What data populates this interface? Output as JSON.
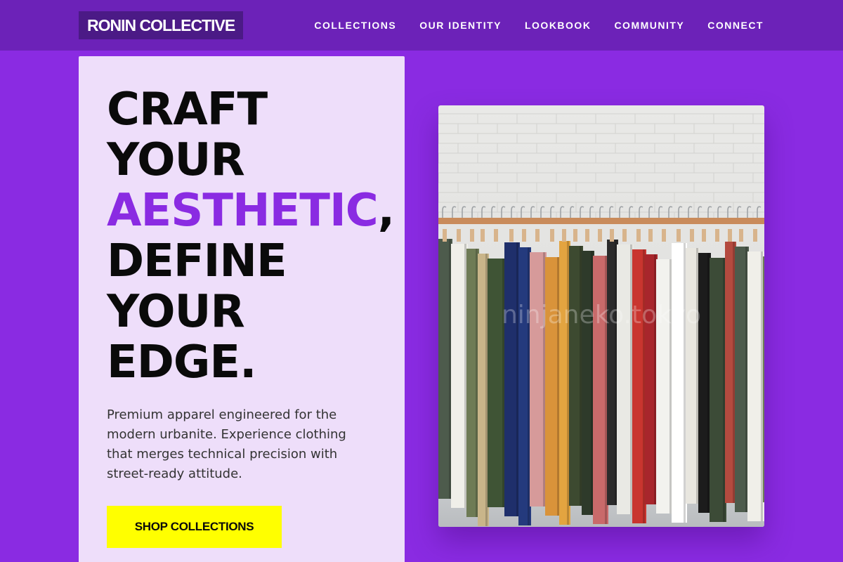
{
  "brand": {
    "name": "RONIN COLLECTIVE"
  },
  "nav": {
    "items": [
      {
        "label": "COLLECTIONS"
      },
      {
        "label": "OUR IDENTITY"
      },
      {
        "label": "LOOKBOOK"
      },
      {
        "label": "COMMUNITY"
      },
      {
        "label": "CONNECT"
      }
    ]
  },
  "hero": {
    "line1": "CRAFT",
    "line2": "YOUR",
    "line3_accent": "AESTHETIC",
    "line3_punct": ",",
    "line4": "DEFINE",
    "line5": "YOUR",
    "line6": "EDGE.",
    "description": "Premium apparel engineered for the modern urbanite. Experience clothing that merges technical precision with street-ready attitude.",
    "cta_label": "SHOP COLLECTIONS"
  },
  "image": {
    "alt": "Clothing rack with assorted garments on hangers",
    "watermark": "ninjaneko.tokyo"
  },
  "colors": {
    "background": "#8a2be2",
    "navbar": "#6c22b8",
    "logo_bg": "#4b1a86",
    "card": "#eedefa",
    "accent": "#8a2be2",
    "cta": "#ffff00"
  }
}
